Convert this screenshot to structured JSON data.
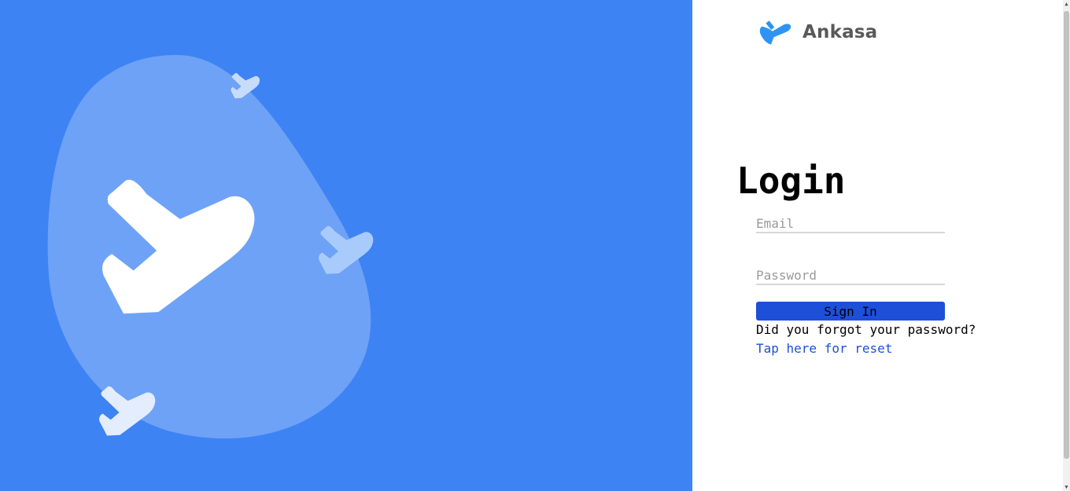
{
  "brand": {
    "name": "Ankasa"
  },
  "login": {
    "title": "Login",
    "email_placeholder": "Email",
    "password_placeholder": "Password",
    "submit_label": "Sign In",
    "forgot_text": "Did you forgot your password?",
    "reset_link": "Tap here for reset"
  },
  "colors": {
    "hero_background": "#3e83f4",
    "button": "#1d4fd8",
    "link": "#1d4fd8"
  },
  "icons": [
    "airplane-illustration",
    "airplane-logo-icon"
  ]
}
